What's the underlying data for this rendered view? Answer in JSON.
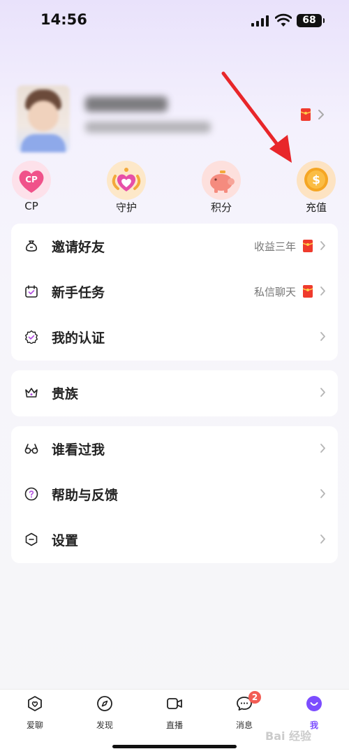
{
  "status_bar": {
    "time": "14:56",
    "battery": "68",
    "signal_icon": "cellular-signal-icon",
    "wifi_icon": "wifi-icon"
  },
  "profile": {
    "avatar_icon": "avatar",
    "redpacket_icon": "red-packet-icon"
  },
  "quick_actions": [
    {
      "label": "CP",
      "icon": "cp-heart-icon"
    },
    {
      "label": "守护",
      "icon": "guard-heart-icon"
    },
    {
      "label": "积分",
      "icon": "piggy-bank-icon"
    },
    {
      "label": "充值",
      "icon": "coin-icon"
    }
  ],
  "menu_group_1": [
    {
      "label": "邀请好友",
      "note": "收益三年",
      "icon": "money-bag-icon",
      "has_packet": true
    },
    {
      "label": "新手任务",
      "note": "私信聊天",
      "icon": "calendar-check-icon",
      "has_packet": true
    },
    {
      "label": "我的认证",
      "note": "",
      "icon": "verified-badge-icon",
      "has_packet": false
    }
  ],
  "menu_group_2": [
    {
      "label": "贵族",
      "icon": "crown-icon"
    }
  ],
  "menu_group_3": [
    {
      "label": "谁看过我",
      "icon": "glasses-icon"
    },
    {
      "label": "帮助与反馈",
      "icon": "help-icon"
    },
    {
      "label": "设置",
      "icon": "settings-hexagon-icon"
    }
  ],
  "bottom_nav": {
    "items": [
      {
        "label": "爱聊",
        "icon": "chat-heart-icon"
      },
      {
        "label": "发现",
        "icon": "compass-icon"
      },
      {
        "label": "直播",
        "icon": "video-camera-icon"
      },
      {
        "label": "消息",
        "icon": "message-icon",
        "badge": "2"
      },
      {
        "label": "我",
        "icon": "smile-icon",
        "active": true
      }
    ]
  },
  "colors": {
    "accent": "#7c4dff",
    "badge": "#f25c54",
    "arrow": "#e8262a",
    "coin": "#f5a623"
  },
  "watermark": "Bai 经验"
}
